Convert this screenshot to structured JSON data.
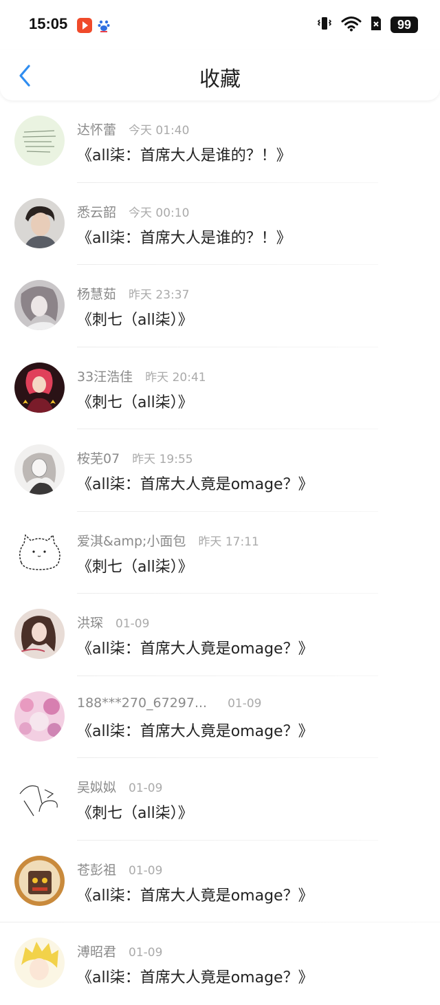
{
  "status": {
    "time": "15:05",
    "battery": "99",
    "icons": [
      "video-app-icon",
      "baidu-paw-icon",
      "vibrate-icon",
      "wifi-icon",
      "sim-x-icon",
      "battery-icon"
    ]
  },
  "header": {
    "title": "收藏",
    "back_icon": "chevron-left-icon"
  },
  "colors": {
    "accent": "#2f8df0",
    "name_gray": "#8a8a8a",
    "time_gray": "#aaaaaa",
    "title_black": "#222222"
  },
  "items": [
    {
      "name": "达怀蕾",
      "time": "今天 01:40",
      "title": "《all柒：首席大人是谁的？！》",
      "avatar": "handwriting-note-avatar"
    },
    {
      "name": "悉云韶",
      "time": "今天 00:10",
      "title": "《all柒：首席大人是谁的？！》",
      "avatar": "young-man-photo-avatar"
    },
    {
      "name": "杨慧茹",
      "time": "昨天 23:37",
      "title": "《刺七（all柒）》",
      "avatar": "anime-girl-gray-avatar"
    },
    {
      "name": "33汪浩佳",
      "time": "昨天 20:41",
      "title": "《刺七（all柒）》",
      "avatar": "anime-red-character-avatar"
    },
    {
      "name": "桉芜07",
      "time": "昨天 19:55",
      "title": "《all柒：首席大人竟是omage？》",
      "avatar": "sketch-girl-avatar"
    },
    {
      "name": "爱淇&amp;小面包",
      "time": "昨天 17:11",
      "title": "《刺七（all柒）》",
      "avatar": "white-cat-sketch-avatar"
    },
    {
      "name": "洪琛",
      "time": "01-09",
      "title": "《all柒：首席大人竟是omage？》",
      "avatar": "girl-photo-avatar"
    },
    {
      "name": "188***270_67297...",
      "time": "01-09",
      "title": "《all柒：首席大人竟是omage？》",
      "avatar": "pink-anime-avatar"
    },
    {
      "name": "吴姒姒",
      "time": "01-09",
      "title": "《刺七（all柒）》",
      "avatar": "line-drawing-avatar"
    },
    {
      "name": "苍彭祖",
      "time": "01-09",
      "title": "《all柒：首席大人竟是omage？》",
      "avatar": "cartoon-badge-avatar"
    },
    {
      "name": "溥昭君",
      "time": "01-09",
      "title": "《all柒：首席大人竟是omage？》",
      "avatar": "blonde-anime-avatar"
    }
  ]
}
